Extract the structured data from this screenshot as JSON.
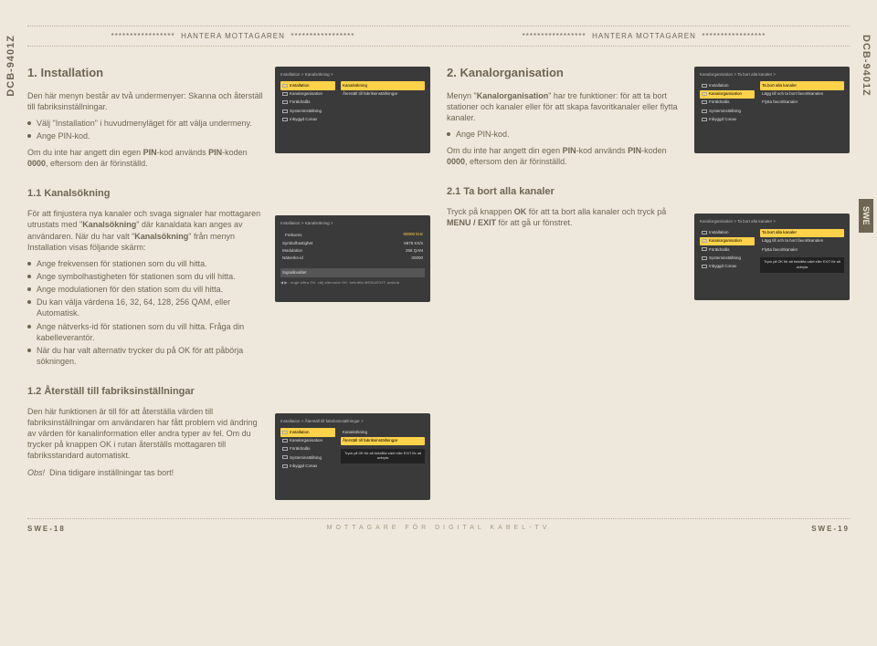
{
  "model_id": "DCB-9401Z",
  "lang_tab": "SWE",
  "header": {
    "decor": "*****************",
    "title": "HANTERA MOTTAGAREN"
  },
  "left": {
    "sec_title": "1. Installation",
    "intro": "Den här menyn består av två undermenyer: Skanna och återställ till fabriksinställningar.",
    "b1": "Välj \"Installation\" i huvudmenyläget för att välja undermeny.",
    "b2": "Ange PIN-kod.",
    "pin_note_a": "Om du inte har angett din egen ",
    "pin_note_b": "PIN",
    "pin_note_c": "-kod används ",
    "pin_note_d": "PIN",
    "pin_note_e": "-koden ",
    "pin_note_f": "0000",
    "pin_note_g": ", eftersom den är förinställd.",
    "tv1": {
      "crumb": "Installation > Kanalsökning >",
      "side": [
        "Installation",
        "Kanalorganisation",
        "Föräldralås",
        "Systeminställning",
        "Inbyggd Conax"
      ],
      "main1": "Kanalsökning",
      "main2": "Återställ till fabriksinställningar"
    },
    "sub1_title": "1.1 Kanalsökning",
    "sub1_p1a": "För att finjustera nya kanaler och svaga signaler har mottagaren utrustats med \"",
    "sub1_p1b": "Kanalsökning",
    "sub1_p1c": "\" där kanaldata kan anges av användaren. När du har valt \"",
    "sub1_p1d": "Kanalsökning",
    "sub1_p1e": "\" från menyn Installation visas följande skärm:",
    "sub1_bullets": [
      "Ange frekvensen för stationen som du vill hitta.",
      "Ange symbolhastigheten för stationen som du vill hitta.",
      "Ange modulationen för den station som du vill hitta.",
      "Du kan välja värdena 16, 32, 64, 128, 256 QAM, eller Automatisk.",
      "Ange nätverks-id för stationen som du vill hitta. Fråga din kabelleverantör.",
      "När du har valt alternativ trycker du på OK för att påbörja sökningen."
    ],
    "tv2": {
      "crumb": "Installation > Kanalsökning >",
      "fields": [
        {
          "k": "Frekvens",
          "v": "00000 kHz"
        },
        {
          "k": "Symbolhastighet",
          "v": "6875 KS/s"
        },
        {
          "k": "Modulation",
          "v": "256 QAM"
        },
        {
          "k": "Nätverks-id",
          "v": "00000"
        }
      ],
      "quality": "Signalkvalitet",
      "hint": "◀ ▶ : ange siffra   OK: välj alternativ   OK: bekräfta   MENU/EXIT: avsluta"
    },
    "sub2_title": "1.2 Återställ till fabriksinställningar",
    "sub2_p": "Den här funktionen är till för att återställa värden till fabriksinställningar om användaren har fått problem vid ändring av värden för kanalinformation eller andra typer av fel. Om du trycker på knappen OK i rutan återställs mottagaren till fabriksstandard automatiskt.",
    "sub2_obs_label": "Obs!",
    "sub2_obs_text": "Dina tidigare inställningar tas bort!",
    "tv3": {
      "crumb": "Installation > Återställ till fabriksinställningar >",
      "side": [
        "Installation",
        "Kanalorganisation",
        "Föräldralås",
        "Systeminställning",
        "Inbyggd Conax"
      ],
      "main1": "Kanalsökning",
      "main2": "Återställ till fabriksinställningar",
      "dialog": "Tryck på OK för att bekräfta valet eller EXIT för att avbryta"
    }
  },
  "right": {
    "sec_title": "2. Kanalorganisation",
    "intro_a": "Menyn \"",
    "intro_b": "Kanalorganisation",
    "intro_c": "\" har tre funktioner: för att ta bort stationer och kanaler eller för att skapa favoritkanaler eller flytta kanaler.",
    "b1": "Ange PIN-kod.",
    "pin_note_a": "Om du inte har angett din egen ",
    "pin_note_b": "PIN",
    "pin_note_c": "-kod används ",
    "pin_note_d": "PIN",
    "pin_note_e": "-koden ",
    "pin_note_f": "0000",
    "pin_note_g": ", eftersom den är förinställd.",
    "tv1": {
      "crumb": "Kanalorganisation > Ta bort alla kanaler >",
      "side": [
        "Installation",
        "Kanalorganisation",
        "Föräldralås",
        "Systeminställning",
        "Inbyggd Conax"
      ],
      "main": [
        "Ta bort alla kanaler",
        "Lägg till och ta bort favoritkanalen",
        "Flytta favoritkanaler"
      ]
    },
    "sub1_title": "2.1 Ta bort alla kanaler",
    "sub1_p_a": "Tryck på knappen ",
    "sub1_p_b": "OK",
    "sub1_p_c": " för att ta bort alla kanaler och tryck på ",
    "sub1_p_d": "MENU / EXIT",
    "sub1_p_e": " för att gå ur fönstret.",
    "tv2": {
      "crumb": "Kanalorganisation > Ta bort alla kanaler >",
      "side": [
        "Installation",
        "Kanalorganisation",
        "Föräldralås",
        "Systeminställning",
        "Inbyggd Conax"
      ],
      "main1": "Ta bort alla kanaler",
      "main2": "Lägg till och ta bort favoritkanalen",
      "main3": "Flytta favoritkanaler",
      "dialog": "Tryck på OK för att bekräfta valet eller EXIT för att avbryta"
    }
  },
  "footer": {
    "left": "SWE-18",
    "mid": "MOTTAGARE  FÖR  DIGITAL  KABEL-TV",
    "right": "SWE-19"
  }
}
